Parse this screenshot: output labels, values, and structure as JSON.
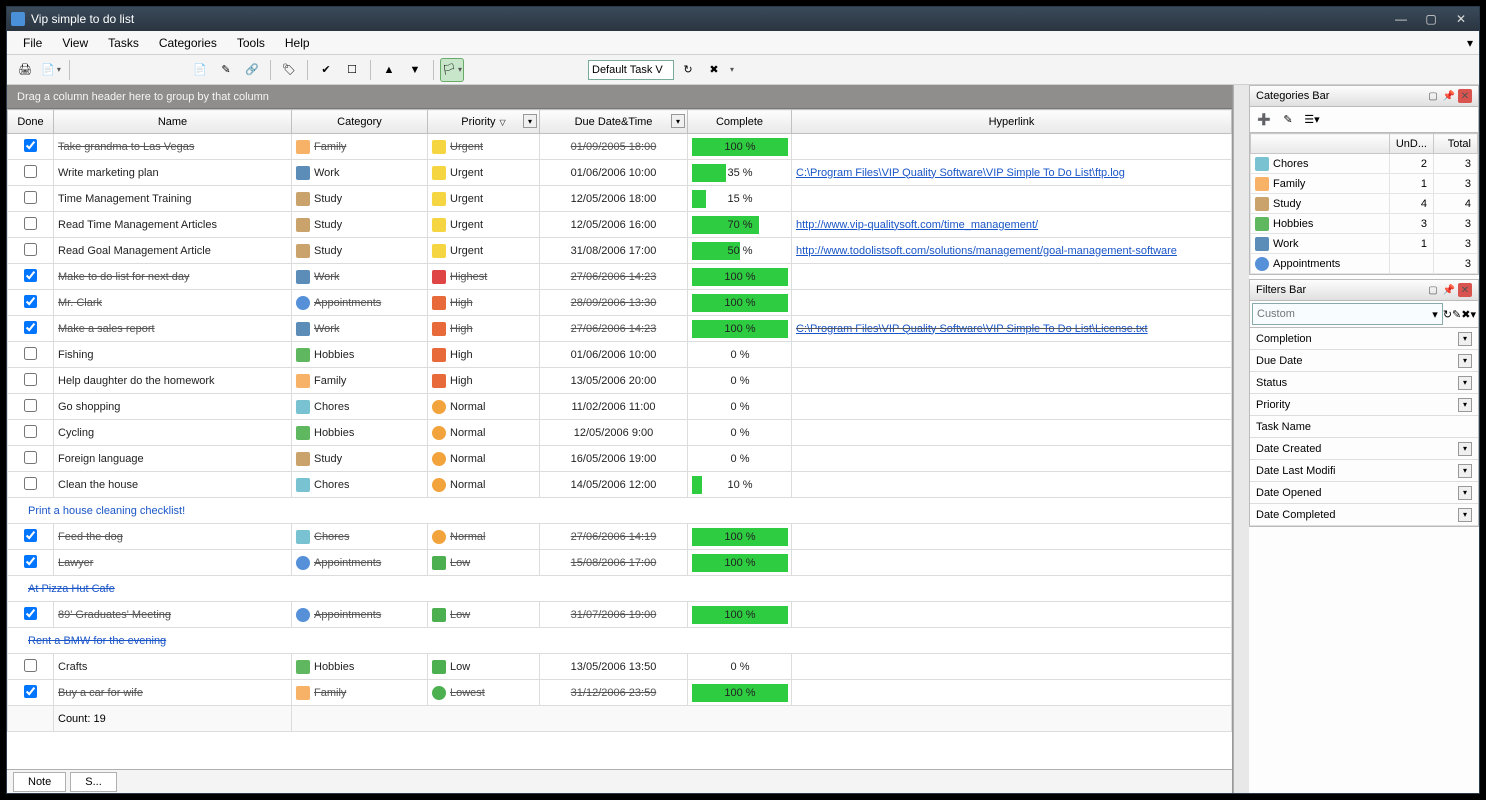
{
  "window": {
    "title": "Vip simple to do list"
  },
  "menu": [
    "File",
    "View",
    "Tasks",
    "Categories",
    "Tools",
    "Help"
  ],
  "toolbar": {
    "view_selector": "Default Task V"
  },
  "grid": {
    "group_hint": "Drag a column header here to group by that column",
    "columns": {
      "done": "Done",
      "name": "Name",
      "category": "Category",
      "priority": "Priority",
      "due": "Due Date&Time",
      "complete": "Complete",
      "hyperlink": "Hyperlink"
    },
    "count_label": "Count: 19",
    "rows": [
      {
        "type": "task",
        "done": true,
        "name": "Take grandma to Las Vegas",
        "cat": "Family",
        "cat_cls": "ci-family",
        "pri": "Urgent",
        "pri_cls": "pi-urgent",
        "due": "01/09/2005 18:00",
        "complete": 100,
        "link": ""
      },
      {
        "type": "task",
        "done": false,
        "name": "Write marketing plan",
        "cat": "Work",
        "cat_cls": "ci-work",
        "pri": "Urgent",
        "pri_cls": "pi-urgent",
        "due": "01/06/2006 10:00",
        "complete": 35,
        "link": "C:\\Program Files\\VIP Quality Software\\VIP Simple To Do List\\ftp.log"
      },
      {
        "type": "task",
        "done": false,
        "name": "Time Management Training",
        "cat": "Study",
        "cat_cls": "ci-study",
        "pri": "Urgent",
        "pri_cls": "pi-urgent",
        "due": "12/05/2006 18:00",
        "complete": 15,
        "link": ""
      },
      {
        "type": "task",
        "done": false,
        "name": "Read Time Management Articles",
        "cat": "Study",
        "cat_cls": "ci-study",
        "pri": "Urgent",
        "pri_cls": "pi-urgent",
        "due": "12/05/2006 16:00",
        "complete": 70,
        "link": "http://www.vip-qualitysoft.com/time_management/"
      },
      {
        "type": "task",
        "done": false,
        "name": "Read Goal Management Article",
        "cat": "Study",
        "cat_cls": "ci-study",
        "pri": "Urgent",
        "pri_cls": "pi-urgent",
        "due": "31/08/2006 17:00",
        "complete": 50,
        "link": "http://www.todolistsoft.com/solutions/management/goal-management-software"
      },
      {
        "type": "task",
        "done": true,
        "name": "Make to do list for next day",
        "cat": "Work",
        "cat_cls": "ci-work",
        "pri": "Highest",
        "pri_cls": "pi-highest",
        "due": "27/06/2006 14:23",
        "complete": 100,
        "link": ""
      },
      {
        "type": "task",
        "done": true,
        "name": "Mr. Clark",
        "cat": "Appointments",
        "cat_cls": "ci-appointments",
        "pri": "High",
        "pri_cls": "pi-high",
        "due": "28/09/2006 13:30",
        "complete": 100,
        "link": ""
      },
      {
        "type": "task",
        "done": true,
        "name": "Make a sales report",
        "cat": "Work",
        "cat_cls": "ci-work",
        "pri": "High",
        "pri_cls": "pi-high",
        "due": "27/06/2006 14:23",
        "complete": 100,
        "link": "C:\\Program Files\\VIP Quality Software\\VIP Simple To Do List\\License.txt"
      },
      {
        "type": "task",
        "done": false,
        "name": "Fishing",
        "cat": "Hobbies",
        "cat_cls": "ci-hobbies",
        "pri": "High",
        "pri_cls": "pi-high",
        "due": "01/06/2006 10:00",
        "complete": 0,
        "link": ""
      },
      {
        "type": "task",
        "done": false,
        "name": "Help daughter do the homework",
        "cat": "Family",
        "cat_cls": "ci-family",
        "pri": "High",
        "pri_cls": "pi-high",
        "due": "13/05/2006 20:00",
        "complete": 0,
        "link": ""
      },
      {
        "type": "task",
        "done": false,
        "name": "Go shopping",
        "cat": "Chores",
        "cat_cls": "ci-chores",
        "pri": "Normal",
        "pri_cls": "pi-normal",
        "due": "11/02/2006 11:00",
        "complete": 0,
        "link": ""
      },
      {
        "type": "task",
        "done": false,
        "name": "Cycling",
        "cat": "Hobbies",
        "cat_cls": "ci-hobbies",
        "pri": "Normal",
        "pri_cls": "pi-normal",
        "due": "12/05/2006 9:00",
        "complete": 0,
        "link": ""
      },
      {
        "type": "task",
        "done": false,
        "name": "Foreign language",
        "cat": "Study",
        "cat_cls": "ci-study",
        "pri": "Normal",
        "pri_cls": "pi-normal",
        "due": "16/05/2006 19:00",
        "complete": 0,
        "link": ""
      },
      {
        "type": "task",
        "done": false,
        "name": "Clean the house",
        "cat": "Chores",
        "cat_cls": "ci-chores",
        "pri": "Normal",
        "pri_cls": "pi-normal",
        "due": "14/05/2006 12:00",
        "complete": 10,
        "link": ""
      },
      {
        "type": "note",
        "done": false,
        "text": "Print a house cleaning checklist!"
      },
      {
        "type": "task",
        "done": true,
        "name": "Feed the dog",
        "cat": "Chores",
        "cat_cls": "ci-chores",
        "pri": "Normal",
        "pri_cls": "pi-normal",
        "due": "27/06/2006 14:19",
        "complete": 100,
        "link": ""
      },
      {
        "type": "task",
        "done": true,
        "name": "Lawyer",
        "cat": "Appointments",
        "cat_cls": "ci-appointments",
        "pri": "Low",
        "pri_cls": "pi-low",
        "due": "15/08/2006 17:00",
        "complete": 100,
        "link": ""
      },
      {
        "type": "note",
        "done": true,
        "text": "At Pizza Hut Cafe"
      },
      {
        "type": "task",
        "done": true,
        "name": "89' Graduates' Meeting",
        "cat": "Appointments",
        "cat_cls": "ci-appointments",
        "pri": "Low",
        "pri_cls": "pi-low",
        "due": "31/07/2006 19:00",
        "complete": 100,
        "link": ""
      },
      {
        "type": "note",
        "done": true,
        "text": "Rent a BMW for the evening"
      },
      {
        "type": "task",
        "done": false,
        "name": "Crafts",
        "cat": "Hobbies",
        "cat_cls": "ci-hobbies",
        "pri": "Low",
        "pri_cls": "pi-low",
        "due": "13/05/2006 13:50",
        "complete": 0,
        "link": ""
      },
      {
        "type": "task",
        "done": true,
        "name": "Buy a car for wife",
        "cat": "Family",
        "cat_cls": "ci-family",
        "pri": "Lowest",
        "pri_cls": "pi-lowest",
        "due": "31/12/2006 23:59",
        "complete": 100,
        "link": ""
      }
    ]
  },
  "footer_tabs": [
    "Note",
    "S..."
  ],
  "categories_panel": {
    "title": "Categories Bar",
    "headers": {
      "name": "",
      "undone": "UnD...",
      "total": "Total"
    },
    "rows": [
      {
        "name": "Chores",
        "cls": "ci-chores",
        "undone": 2,
        "total": 3
      },
      {
        "name": "Family",
        "cls": "ci-family",
        "undone": 1,
        "total": 3
      },
      {
        "name": "Study",
        "cls": "ci-study",
        "undone": 4,
        "total": 4
      },
      {
        "name": "Hobbies",
        "cls": "ci-hobbies",
        "undone": 3,
        "total": 3
      },
      {
        "name": "Work",
        "cls": "ci-work",
        "undone": 1,
        "total": 3
      },
      {
        "name": "Appointments",
        "cls": "ci-appointments",
        "undone": "",
        "total": 3
      }
    ]
  },
  "filters_panel": {
    "title": "Filters Bar",
    "custom_placeholder": "Custom",
    "rows": [
      {
        "label": "Completion",
        "dd": true
      },
      {
        "label": "Due Date",
        "dd": true
      },
      {
        "label": "Status",
        "dd": true
      },
      {
        "label": "Priority",
        "dd": true
      },
      {
        "label": "Task Name",
        "dd": false
      },
      {
        "label": "Date Created",
        "dd": true
      },
      {
        "label": "Date Last Modifi",
        "dd": true
      },
      {
        "label": "Date Opened",
        "dd": true
      },
      {
        "label": "Date Completed",
        "dd": true
      }
    ]
  }
}
